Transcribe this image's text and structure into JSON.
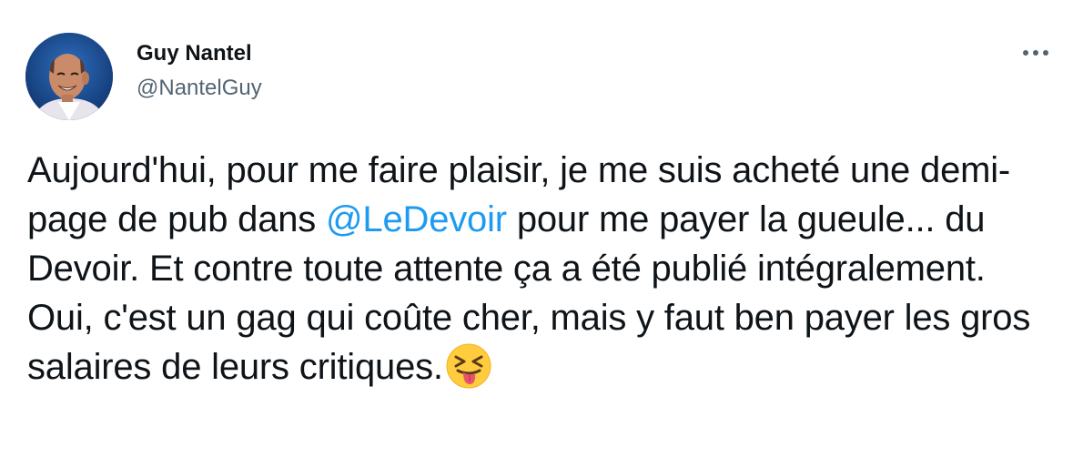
{
  "author": {
    "display_name": "Guy Nantel",
    "handle": "@NantelGuy"
  },
  "tweet": {
    "text_part1": "Aujourd'hui, pour me faire plaisir, je me suis acheté une demi-page de pub dans ",
    "mention": "@LeDevoir",
    "text_part2": " pour me payer la gueule... du Devoir. Et contre toute attente ça a été publié intégralement. Oui, c'est un gag qui coûte cher, mais y faut ben payer les gros salaires de leurs critiques.",
    "emoji": "squinting-face-with-tongue"
  },
  "icons": {
    "more": "more-horizontal-icon"
  },
  "colors": {
    "text": "#0f1419",
    "secondary_text": "#536471",
    "link": "#1d9bf0"
  }
}
